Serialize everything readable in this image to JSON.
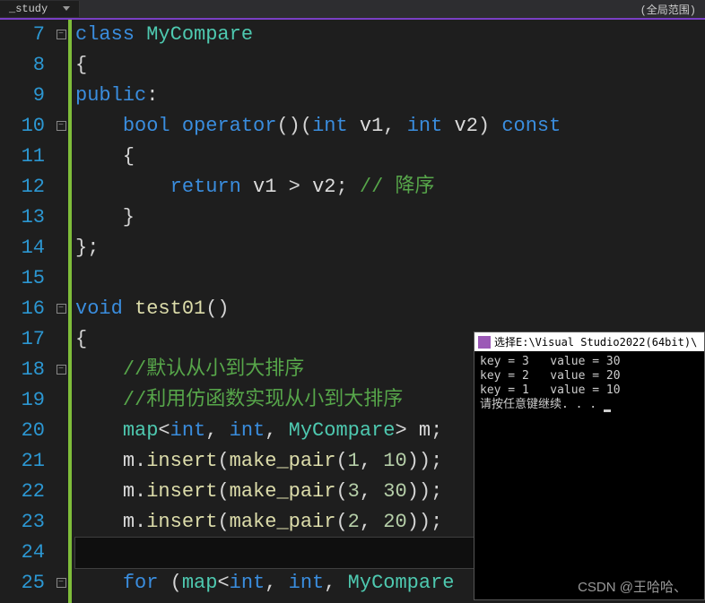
{
  "tab": "_study",
  "scope": "(全局范围)",
  "line_start": 7,
  "code_lines": [
    {
      "n": 7,
      "fold": "-",
      "tokens": [
        {
          "t": "class ",
          "c": "kw"
        },
        {
          "t": "MyCompare",
          "c": "typ"
        }
      ]
    },
    {
      "n": 8,
      "fold": "",
      "tokens": [
        {
          "t": "{",
          "c": "pn"
        }
      ]
    },
    {
      "n": 9,
      "fold": "",
      "tokens": [
        {
          "t": "public",
          "c": "kw"
        },
        {
          "t": ":",
          "c": "pn"
        }
      ]
    },
    {
      "n": 10,
      "fold": "-",
      "tokens": [
        {
          "t": "    ",
          "c": ""
        },
        {
          "t": "bool ",
          "c": "kw"
        },
        {
          "t": "operator",
          "c": "kw"
        },
        {
          "t": "()(",
          "c": "pn"
        },
        {
          "t": "int ",
          "c": "kw"
        },
        {
          "t": "v1",
          "c": "id"
        },
        {
          "t": ", ",
          "c": "pn"
        },
        {
          "t": "int ",
          "c": "kw"
        },
        {
          "t": "v2",
          "c": "id"
        },
        {
          "t": ") ",
          "c": "pn"
        },
        {
          "t": "const",
          "c": "kw"
        }
      ]
    },
    {
      "n": 11,
      "fold": "",
      "tokens": [
        {
          "t": "    {",
          "c": "pn"
        }
      ]
    },
    {
      "n": 12,
      "fold": "",
      "tokens": [
        {
          "t": "        ",
          "c": ""
        },
        {
          "t": "return ",
          "c": "kw"
        },
        {
          "t": "v1 ",
          "c": "id"
        },
        {
          "t": "> ",
          "c": "op"
        },
        {
          "t": "v2",
          "c": "id"
        },
        {
          "t": "; ",
          "c": "pn"
        },
        {
          "t": "// 降序",
          "c": "cm"
        }
      ]
    },
    {
      "n": 13,
      "fold": "",
      "tokens": [
        {
          "t": "    }",
          "c": "pn"
        }
      ]
    },
    {
      "n": 14,
      "fold": "",
      "tokens": [
        {
          "t": "};",
          "c": "pn"
        }
      ]
    },
    {
      "n": 15,
      "fold": "",
      "tokens": []
    },
    {
      "n": 16,
      "fold": "-",
      "tokens": [
        {
          "t": "void ",
          "c": "kw"
        },
        {
          "t": "test01",
          "c": "fn"
        },
        {
          "t": "()",
          "c": "pn"
        }
      ]
    },
    {
      "n": 17,
      "fold": "",
      "tokens": [
        {
          "t": "{",
          "c": "pn"
        }
      ]
    },
    {
      "n": 18,
      "fold": "-",
      "tokens": [
        {
          "t": "    ",
          "c": ""
        },
        {
          "t": "//默认从小到大排序",
          "c": "cm"
        }
      ]
    },
    {
      "n": 19,
      "fold": "",
      "tokens": [
        {
          "t": "    ",
          "c": ""
        },
        {
          "t": "//利用仿函数实现从小到大排序",
          "c": "cm"
        }
      ]
    },
    {
      "n": 20,
      "fold": "",
      "tokens": [
        {
          "t": "    ",
          "c": ""
        },
        {
          "t": "map",
          "c": "typ"
        },
        {
          "t": "<",
          "c": "pn"
        },
        {
          "t": "int",
          "c": "kw"
        },
        {
          "t": ", ",
          "c": "pn"
        },
        {
          "t": "int",
          "c": "kw"
        },
        {
          "t": ", ",
          "c": "pn"
        },
        {
          "t": "MyCompare",
          "c": "typ"
        },
        {
          "t": "> ",
          "c": "pn"
        },
        {
          "t": "m",
          "c": "id"
        },
        {
          "t": ";",
          "c": "pn"
        }
      ]
    },
    {
      "n": 21,
      "fold": "",
      "tokens": [
        {
          "t": "    ",
          "c": ""
        },
        {
          "t": "m",
          "c": "id"
        },
        {
          "t": ".",
          "c": "pn"
        },
        {
          "t": "insert",
          "c": "fn"
        },
        {
          "t": "(",
          "c": "pn"
        },
        {
          "t": "make_pair",
          "c": "fn"
        },
        {
          "t": "(",
          "c": "pn"
        },
        {
          "t": "1",
          "c": "num"
        },
        {
          "t": ", ",
          "c": "pn"
        },
        {
          "t": "10",
          "c": "num"
        },
        {
          "t": "));",
          "c": "pn"
        }
      ]
    },
    {
      "n": 22,
      "fold": "",
      "tokens": [
        {
          "t": "    ",
          "c": ""
        },
        {
          "t": "m",
          "c": "id"
        },
        {
          "t": ".",
          "c": "pn"
        },
        {
          "t": "insert",
          "c": "fn"
        },
        {
          "t": "(",
          "c": "pn"
        },
        {
          "t": "make_pair",
          "c": "fn"
        },
        {
          "t": "(",
          "c": "pn"
        },
        {
          "t": "3",
          "c": "num"
        },
        {
          "t": ", ",
          "c": "pn"
        },
        {
          "t": "30",
          "c": "num"
        },
        {
          "t": "));",
          "c": "pn"
        }
      ]
    },
    {
      "n": 23,
      "fold": "",
      "tokens": [
        {
          "t": "    ",
          "c": ""
        },
        {
          "t": "m",
          "c": "id"
        },
        {
          "t": ".",
          "c": "pn"
        },
        {
          "t": "insert",
          "c": "fn"
        },
        {
          "t": "(",
          "c": "pn"
        },
        {
          "t": "make_pair",
          "c": "fn"
        },
        {
          "t": "(",
          "c": "pn"
        },
        {
          "t": "2",
          "c": "num"
        },
        {
          "t": ", ",
          "c": "pn"
        },
        {
          "t": "20",
          "c": "num"
        },
        {
          "t": "));",
          "c": "pn"
        }
      ]
    },
    {
      "n": 24,
      "fold": "",
      "tokens": [],
      "cursor": true
    },
    {
      "n": 25,
      "fold": "-",
      "tokens": [
        {
          "t": "    ",
          "c": ""
        },
        {
          "t": "for ",
          "c": "kw"
        },
        {
          "t": "(",
          "c": "pn"
        },
        {
          "t": "map",
          "c": "typ"
        },
        {
          "t": "<",
          "c": "pn"
        },
        {
          "t": "int",
          "c": "kw"
        },
        {
          "t": ", ",
          "c": "pn"
        },
        {
          "t": "int",
          "c": "kw"
        },
        {
          "t": ", ",
          "c": "pn"
        },
        {
          "t": "MyCompare",
          "c": "typ"
        }
      ]
    }
  ],
  "console": {
    "title": "选择E:\\Visual Studio2022(64bit)\\",
    "lines": [
      "key = 3   value = 30",
      "key = 2   value = 20",
      "key = 1   value = 10",
      "请按任意键继续. . . "
    ]
  },
  "watermark": "CSDN @王哈哈、"
}
